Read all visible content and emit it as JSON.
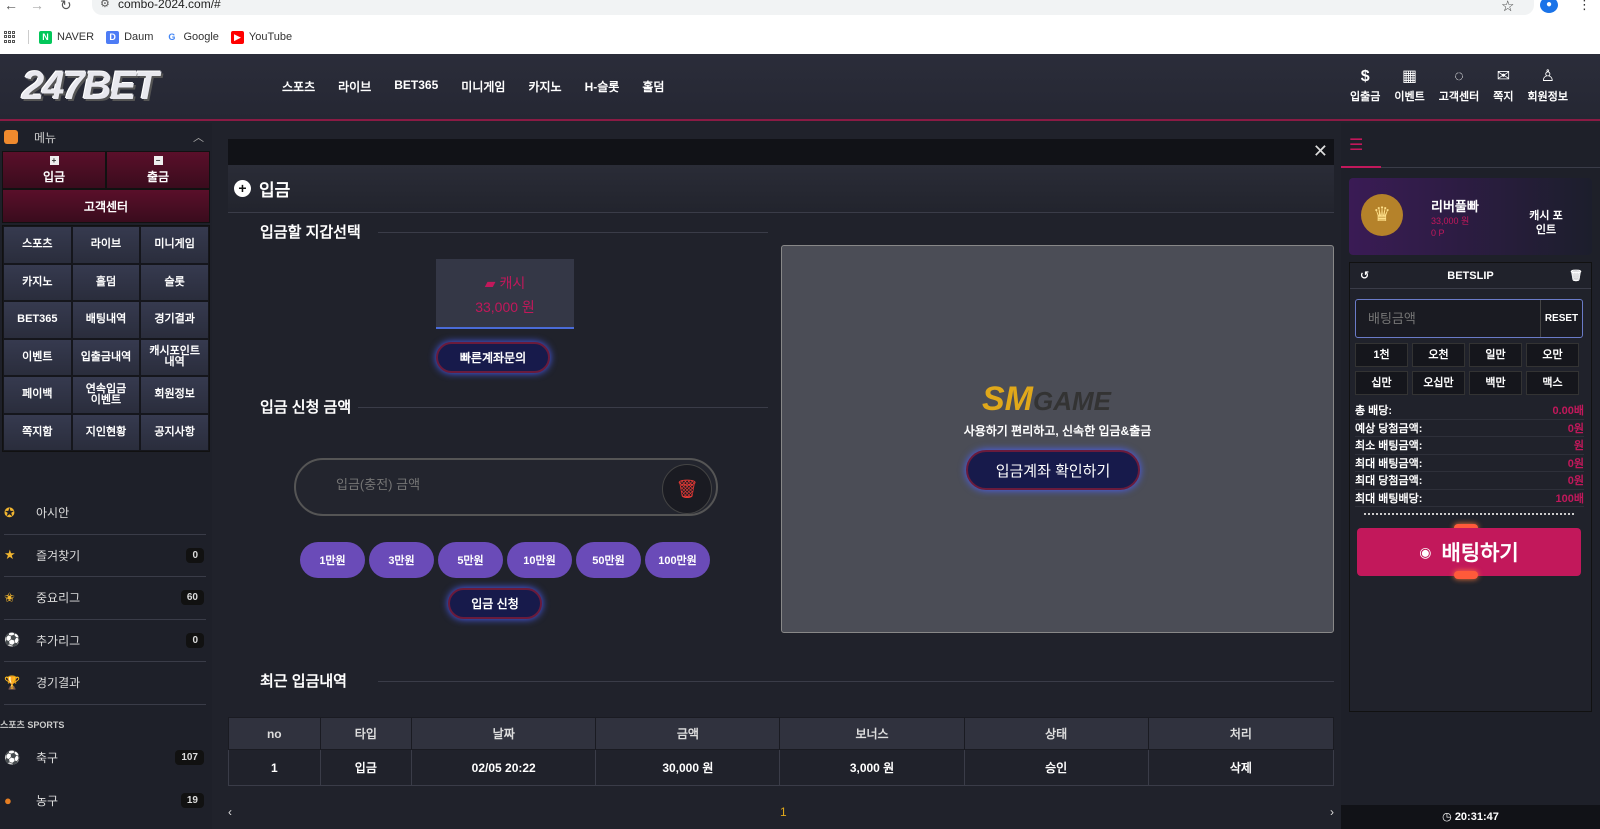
{
  "browser": {
    "url": "combo-2024.com/#",
    "bookmarks": [
      "NAVER",
      "Daum",
      "Google",
      "YouTube"
    ]
  },
  "header": {
    "logo_text": "247BET",
    "nav": [
      "스포츠",
      "라이브",
      "BET365",
      "미니게임",
      "카지노",
      "H-슬롯",
      "홀덤"
    ],
    "icons": [
      {
        "label": "입출금",
        "icon": "dollar-icon"
      },
      {
        "label": "이벤트",
        "icon": "calendar-icon"
      },
      {
        "label": "고객센터",
        "icon": "chat-icon"
      },
      {
        "label": "쪽지",
        "icon": "mail-icon"
      },
      {
        "label": "회원정보",
        "icon": "user-icon"
      }
    ]
  },
  "sidebar": {
    "menu_title": "메뉴",
    "deposit": "입금",
    "withdraw": "출금",
    "customer_center": "고객센터",
    "grid": [
      "스포츠",
      "라이브",
      "미니게임",
      "카지노",
      "홀덤",
      "슬롯",
      "BET365",
      "배팅내역",
      "경기결과",
      "이벤트",
      "입출금내역",
      "캐시포인트내역",
      "페이백",
      "연속입금이벤트",
      "회원정보",
      "쪽지함",
      "지인현황",
      "공지사항"
    ],
    "list": [
      {
        "label": "아시안",
        "count": ""
      },
      {
        "label": "즐겨찾기",
        "count": "0"
      },
      {
        "label": "중요리그",
        "count": "60"
      },
      {
        "label": "추가리그",
        "count": "0"
      },
      {
        "label": "경기결과",
        "count": ""
      }
    ],
    "sports_header": "스포츠 SPORTS",
    "sports": [
      {
        "label": "축구",
        "count": "107"
      },
      {
        "label": "농구",
        "count": "19"
      }
    ]
  },
  "main": {
    "title": "입금",
    "wallet_section": "입금할 지갑선택",
    "wallet_name": "캐시",
    "wallet_amount": "33,000 원",
    "quick_account": "빠른계좌문의",
    "amount_section": "입금 신청 금액",
    "amount_placeholder": "입금(충전) 금액",
    "amount_buttons": [
      "1만원",
      "3만원",
      "5만원",
      "10만원",
      "50만원",
      "100만원"
    ],
    "submit": "입금 신청",
    "history_section": "최근 입금내역",
    "table_headers": [
      "no",
      "타입",
      "날짜",
      "금액",
      "보너스",
      "상태",
      "처리"
    ],
    "table_rows": [
      [
        "1",
        "입금",
        "02/05 20:22",
        "30,000 원",
        "3,000 원",
        "승인",
        "삭제"
      ]
    ],
    "page": "1"
  },
  "modal": {
    "logo_main": "SM",
    "logo_sub": "GAME",
    "tagline": "사용하기 편리하고, 신속한 입금&출금",
    "button": "입금계좌 확인하기"
  },
  "right": {
    "user": {
      "name": "리버풀빠",
      "cash": "33,000 원",
      "points": "0 P",
      "cash_point": "캐시 포인트"
    },
    "betslip": {
      "title": "BETSLIP",
      "placeholder": "배팅금액",
      "reset": "RESET",
      "chips": [
        "1천",
        "오천",
        "일만",
        "오만",
        "십만",
        "오십만",
        "백만",
        "맥스"
      ],
      "rows": [
        {
          "k": "총 배당:",
          "v": "0.00배"
        },
        {
          "k": "예상 당첨금액:",
          "v": "0원"
        },
        {
          "k": "최소 배팅금액:",
          "v": "원"
        },
        {
          "k": "최대 배팅금액:",
          "v": "0원"
        },
        {
          "k": "최대 당첨금액:",
          "v": "0원"
        },
        {
          "k": "최대 배팅배당:",
          "v": "100배"
        }
      ],
      "bet_button": "배팅하기"
    },
    "clock": "20:31:47"
  }
}
